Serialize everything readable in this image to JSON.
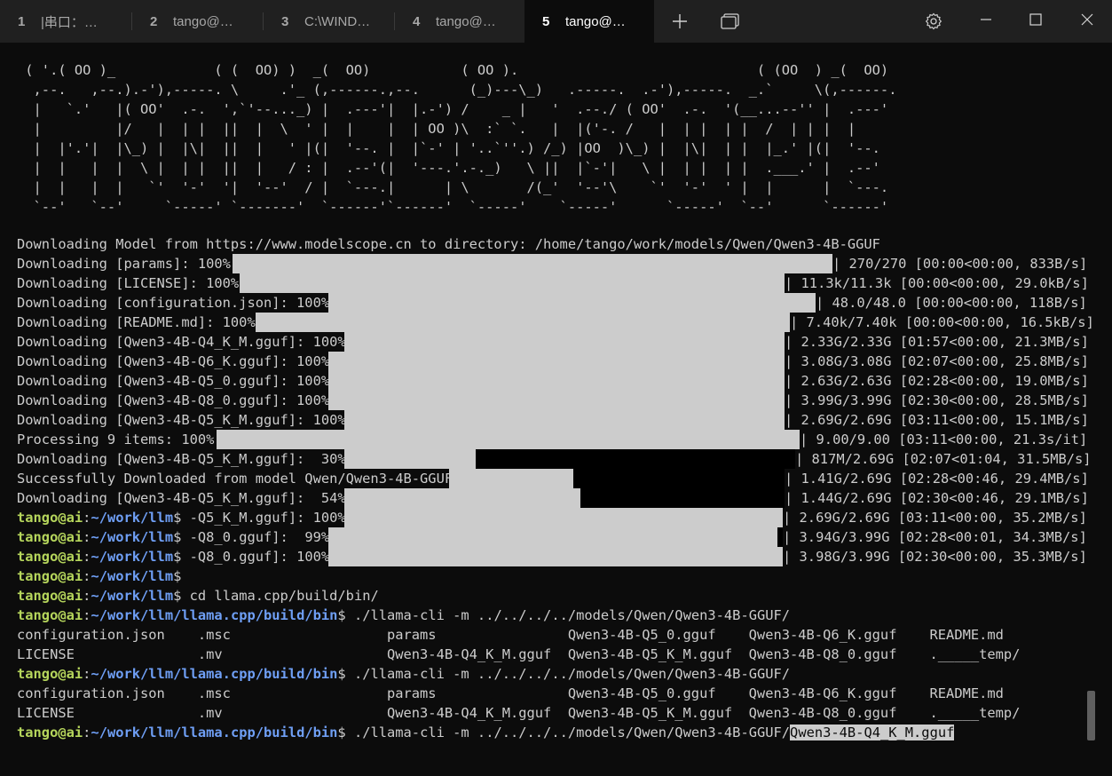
{
  "tabs": [
    {
      "num": "1",
      "title": "|串口：…",
      "active": false
    },
    {
      "num": "2",
      "title": "tango@…",
      "active": false
    },
    {
      "num": "3",
      "title": "C:\\WIND…",
      "active": false
    },
    {
      "num": "4",
      "title": "tango@…",
      "active": false
    },
    {
      "num": "5",
      "title": "tango@…",
      "active": true
    }
  ],
  "toolbar": {
    "new_tab_icon": "plus-icon",
    "dropdown_icon": "tabs-icon",
    "settings_icon": "gear-icon"
  },
  "window": {
    "minimize": "minimize-icon",
    "maximize": "maximize-icon",
    "close": "close-icon"
  },
  "ascii_art": " ( '.( OO )_            ( (  OO) )  _(  OO)           ( OO ).                             ( (OO  ) _(  OO)\n  ,--.   ,--.).-'),-----. \\     .'_ (,------.,--.      (_)---\\_)   .-----.  .-'),-----.  _.`     \\(,------.\n  |   `.'   |( OO'  .-.  ',`'--..._) |  .---'|  |.-') /    _ |   '  .--./ ( OO'  .-.  '(__...--'' |  .---'\n  |         |/   |  | |  ||  |  \\  ' |  |    |  | OO )\\  :` `.   |  |('-. /   |  | |  | |  /  | | |  |\n  |  |'.'|  |\\_) |  |\\|  ||  |   ' |(|  '--. |  |`-' | '..`''.) /_) |OO  )\\_) |  |\\|  | |  |_.' |(|  '--.\n  |  |   |  |  \\ |  | |  ||  |   / : |  .--'(|  '---.'.-._)   \\ ||  |`-'|   \\ |  | |  | |  .___.' |  .--'\n  |  |   |  |   `'  '-'  '|  '--'  / |  `---.|      | \\       /(_'  '--'\\    `'  '-'  ' |  |      |  `---.\n  `--'   `--'     `-----' `-------'  `------'`------'  `-----'    `-----'      `-----'  `--'      `------'",
  "download_lines": [
    {
      "label": "Downloading Model from https://www.modelscope.cn to directory: /home/tango/work/models/Qwen/Qwen3-4B-GGUF",
      "stats": ""
    },
    {
      "label": "Downloading [params]: 100%|",
      "stats": "| 270/270 [00:00<00:00, 833B/s]",
      "progress": 1.0
    },
    {
      "label": "Downloading [LICENSE]: 100%|",
      "stats": "| 11.3k/11.3k [00:00<00:00, 29.0kB/s]",
      "progress": 1.0
    },
    {
      "label": "Downloading [configuration.json]: 100%|",
      "stats": "| 48.0/48.0 [00:00<00:00, 118B/s]",
      "progress": 1.0
    },
    {
      "label": "Downloading [README.md]: 100%|",
      "stats": "| 7.40k/7.40k [00:00<00:00, 16.5kB/s]",
      "progress": 1.0
    },
    {
      "label": "Downloading [Qwen3-4B-Q4_K_M.gguf]: 100%|",
      "stats": "| 2.33G/2.33G [01:57<00:00, 21.3MB/s]",
      "progress": 1.0
    },
    {
      "label": "Downloading [Qwen3-4B-Q6_K.gguf]: 100%|",
      "stats": "| 3.08G/3.08G [02:07<00:00, 25.8MB/s]",
      "progress": 1.0
    },
    {
      "label": "Downloading [Qwen3-4B-Q5_0.gguf]: 100%|",
      "stats": "| 2.63G/2.63G [02:28<00:00, 19.0MB/s]",
      "progress": 1.0
    },
    {
      "label": "Downloading [Qwen3-4B-Q8_0.gguf]: 100%|",
      "stats": "| 3.99G/3.99G [02:30<00:00, 28.5MB/s]",
      "progress": 1.0
    },
    {
      "label": "Downloading [Qwen3-4B-Q5_K_M.gguf]: 100%|",
      "stats": "| 2.69G/2.69G [03:11<00:00, 15.1MB/s]",
      "progress": 1.0
    },
    {
      "label": "Processing 9 items: 100%|",
      "stats": "| 9.00/9.00 [03:11<00:00, 21.3s/it]",
      "progress": 1.0
    },
    {
      "label": "Downloading [Qwen3-4B-Q5_K_M.gguf]:  30%|",
      "stats": "| 817M/2.69G [02:07<01:04, 31.5MB/s]",
      "progress": 0.3
    },
    {
      "label": "Successfully Downloaded from model Qwen/Qwen3-4B-GGUF.",
      "stats": "| 1.41G/2.69G [02:28<00:46, 29.4MB/s]",
      "progress": 0.52
    },
    {
      "label": "Downloading [Qwen3-4B-Q5_K_M.gguf]:  54%|",
      "stats": "| 1.44G/2.69G [02:30<00:46, 29.1MB/s]",
      "progress": 0.54
    }
  ],
  "prompt_lines": [
    {
      "user": "tango@ai",
      "path": "~/work/llm",
      "cmd": "$ -Q5_K_M.gguf]: 100%|",
      "stats": "| 2.69G/2.69G [03:11<00:00, 35.2MB/s]",
      "progress": 1.0
    },
    {
      "user": "tango@ai",
      "path": "~/work/llm",
      "cmd": "$ -Q8_0.gguf]:  99%|",
      "stats": "| 3.94G/3.99G [02:28<00:01, 34.3MB/s]",
      "progress": 0.99
    },
    {
      "user": "tango@ai",
      "path": "~/work/llm",
      "cmd": "$ -Q8_0.gguf]: 100%|",
      "stats": "| 3.98G/3.99G [02:30<00:00, 35.3MB/s]",
      "progress": 1.0
    },
    {
      "user": "tango@ai",
      "path": "~/work/llm",
      "cmd": "$",
      "stats": ""
    },
    {
      "user": "tango@ai",
      "path": "~/work/llm",
      "cmd": "$ cd llama.cpp/build/bin/",
      "stats": ""
    },
    {
      "user": "tango@ai",
      "path": "~/work/llm/llama.cpp/build/bin",
      "cmd": "$ ./llama-cli -m ../../../../models/Qwen/Qwen3-4B-GGUF/",
      "stats": ""
    }
  ],
  "listing1": [
    "configuration.json    .msc                   params                Qwen3-4B-Q5_0.gguf    Qwen3-4B-Q6_K.gguf    README.md",
    "LICENSE               .mv                    Qwen3-4B-Q4_K_M.gguf  Qwen3-4B-Q5_K_M.gguf  Qwen3-4B-Q8_0.gguf    ._____temp/"
  ],
  "prompt_repeat": {
    "user": "tango@ai",
    "path": "~/work/llm/llama.cpp/build/bin",
    "cmd": "$ ./llama-cli -m ../../../../models/Qwen/Qwen3-4B-GGUF/"
  },
  "listing2": [
    "configuration.json    .msc                   params                Qwen3-4B-Q5_0.gguf    Qwen3-4B-Q6_K.gguf    README.md",
    "LICENSE               .mv                    Qwen3-4B-Q4_K_M.gguf  Qwen3-4B-Q5_K_M.gguf  Qwen3-4B-Q8_0.gguf    ._____temp/"
  ],
  "final_prompt": {
    "user": "tango@ai",
    "path": "~/work/llm/llama.cpp/build/bin",
    "cmd": "$ ./llama-cli -m ../../../../models/Qwen/Qwen3-4B-GGUF/",
    "completion": "Qwen3-4B-Q4_K_M.gguf"
  }
}
